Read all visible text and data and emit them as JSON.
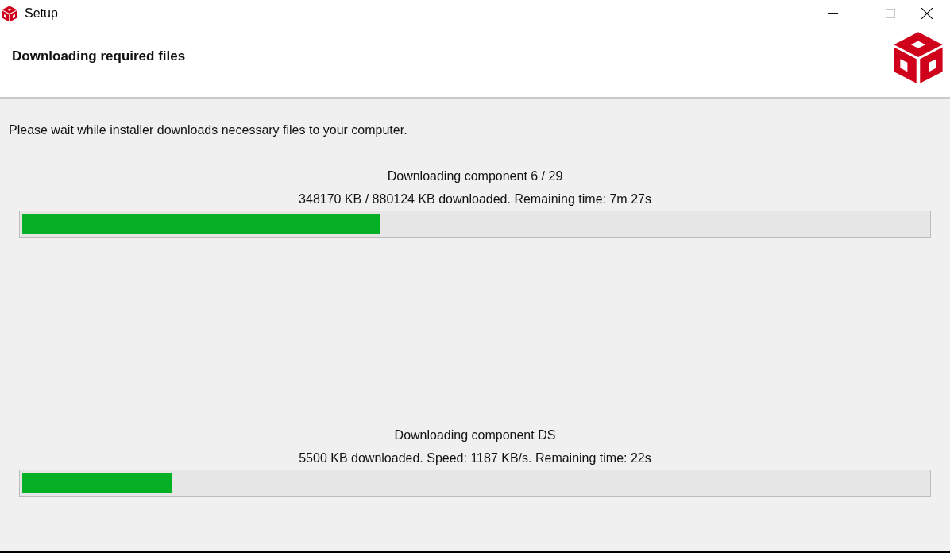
{
  "window": {
    "title": "Setup"
  },
  "header": {
    "title": "Downloading required files"
  },
  "intro": "Please wait while installer downloads necessary files to your computer.",
  "downloads": [
    {
      "heading": "Downloading component 6 / 29",
      "detail": "348170 KB / 880124 KB downloaded. Remaining time: 7m 27s",
      "level": 0.395
    },
    {
      "heading": "Downloading component DS",
      "detail": "5500 KB downloaded. Speed: 1187 KB/s. Remaining time:  22s",
      "level": 0.166
    }
  ]
}
